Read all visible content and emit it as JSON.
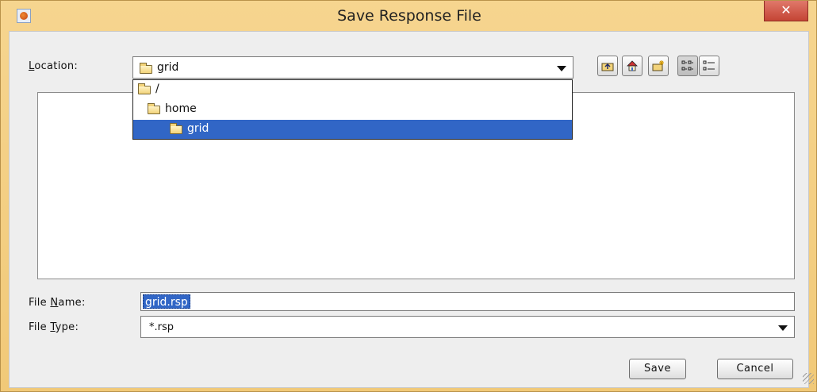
{
  "window": {
    "title": "Save Response File",
    "close_label": "✕"
  },
  "location": {
    "label_accel": "L",
    "label_rest": "ocation:",
    "current": "grid",
    "options": [
      "/",
      "home",
      "grid"
    ],
    "selected_index": 2
  },
  "toolbar": {
    "icons": [
      "up-one-level-icon",
      "home-icon",
      "new-folder-icon",
      "list-view-icon",
      "details-view-icon"
    ]
  },
  "file_name": {
    "label_pre": "File ",
    "label_accel": "N",
    "label_rest": "ame:",
    "value": "grid.rsp"
  },
  "file_type": {
    "label_pre": "File ",
    "label_accel": "T",
    "label_rest": "ype:",
    "value": "*.rsp"
  },
  "buttons": {
    "save": "Save",
    "cancel": "Cancel"
  },
  "colors": {
    "title_bar": "#f3cf88",
    "selection": "#3166c6",
    "close": "#c44535"
  }
}
